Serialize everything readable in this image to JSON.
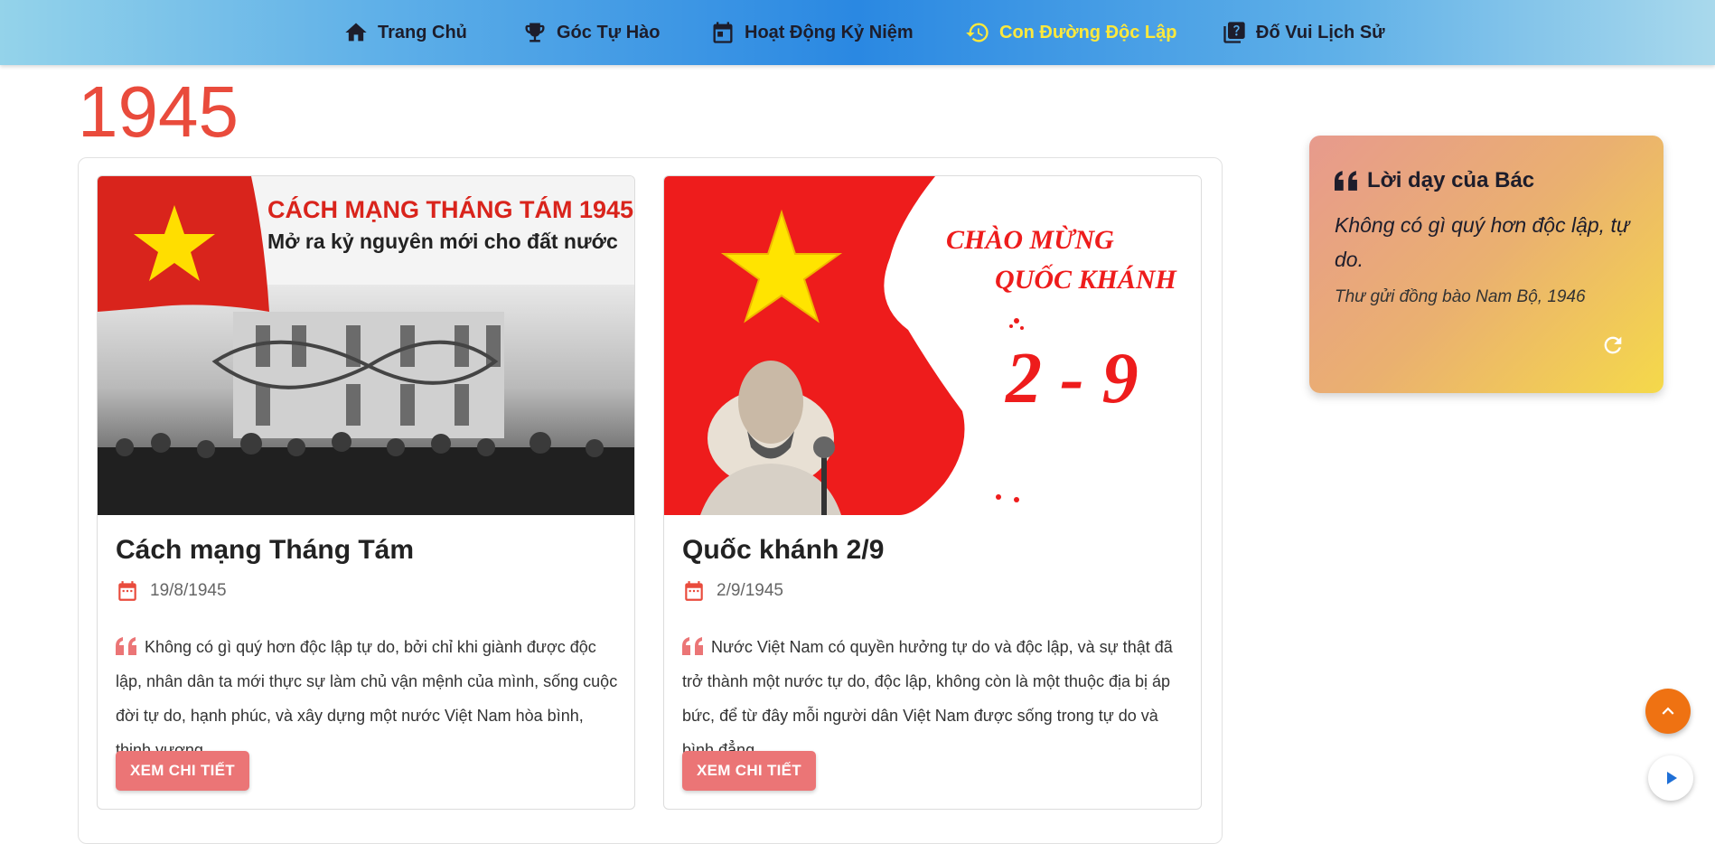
{
  "nav": {
    "items": [
      {
        "label": "Trang Chủ",
        "icon": "home-icon"
      },
      {
        "label": "Góc Tự Hào",
        "icon": "trophy-icon"
      },
      {
        "label": "Hoạt Động Kỷ Niệm",
        "icon": "calendar-icon"
      },
      {
        "label": "Con Đường Độc Lập",
        "icon": "history-icon",
        "active": true
      },
      {
        "label": "Đố Vui Lịch Sử",
        "icon": "quiz-icon"
      }
    ]
  },
  "main": {
    "year": "1945",
    "cards": [
      {
        "image": {
          "banner_line1": "CÁCH MẠNG THÁNG TÁM 1945",
          "banner_line2": "Mở ra kỷ nguyên mới cho đất nước"
        },
        "title": "Cách mạng Tháng Tám",
        "date": "19/8/1945",
        "quote": "Không có gì quý hơn độc lập tự do, bởi chỉ khi giành được độc lập, nhân dân ta mới thực sự làm chủ vận mệnh của mình, sống cuộc đời tự do, hạnh phúc, và xây dựng một nước Việt Nam hòa bình, thịnh vượng.",
        "button": "XEM CHI TIẾT"
      },
      {
        "image": {
          "line1": "CHÀO MỪNG",
          "line2": "QUỐC KHÁNH",
          "line3": "2 - 9"
        },
        "title": "Quốc khánh 2/9",
        "date": "2/9/1945",
        "quote": "Nước Việt Nam có quyền hưởng tự do và độc lập, và sự thật đã trở thành một nước tự do, độc lập, không còn là một thuộc địa bị áp bức, để từ đây mỗi người dân Việt Nam được sống trong tự do và bình đẳng.",
        "button": "XEM CHI TIẾT"
      }
    ]
  },
  "quote_widget": {
    "title": "Lời dạy của Bác",
    "text": "Không có gì quý hơn độc lập, tự do.",
    "source": "Thư gửi đồng bào Nam Bộ, 1946"
  },
  "colors": {
    "accent": "#e94b3c",
    "button": "#eb7576",
    "nav_active": "#ffe93b",
    "fab": "#ef7212"
  }
}
